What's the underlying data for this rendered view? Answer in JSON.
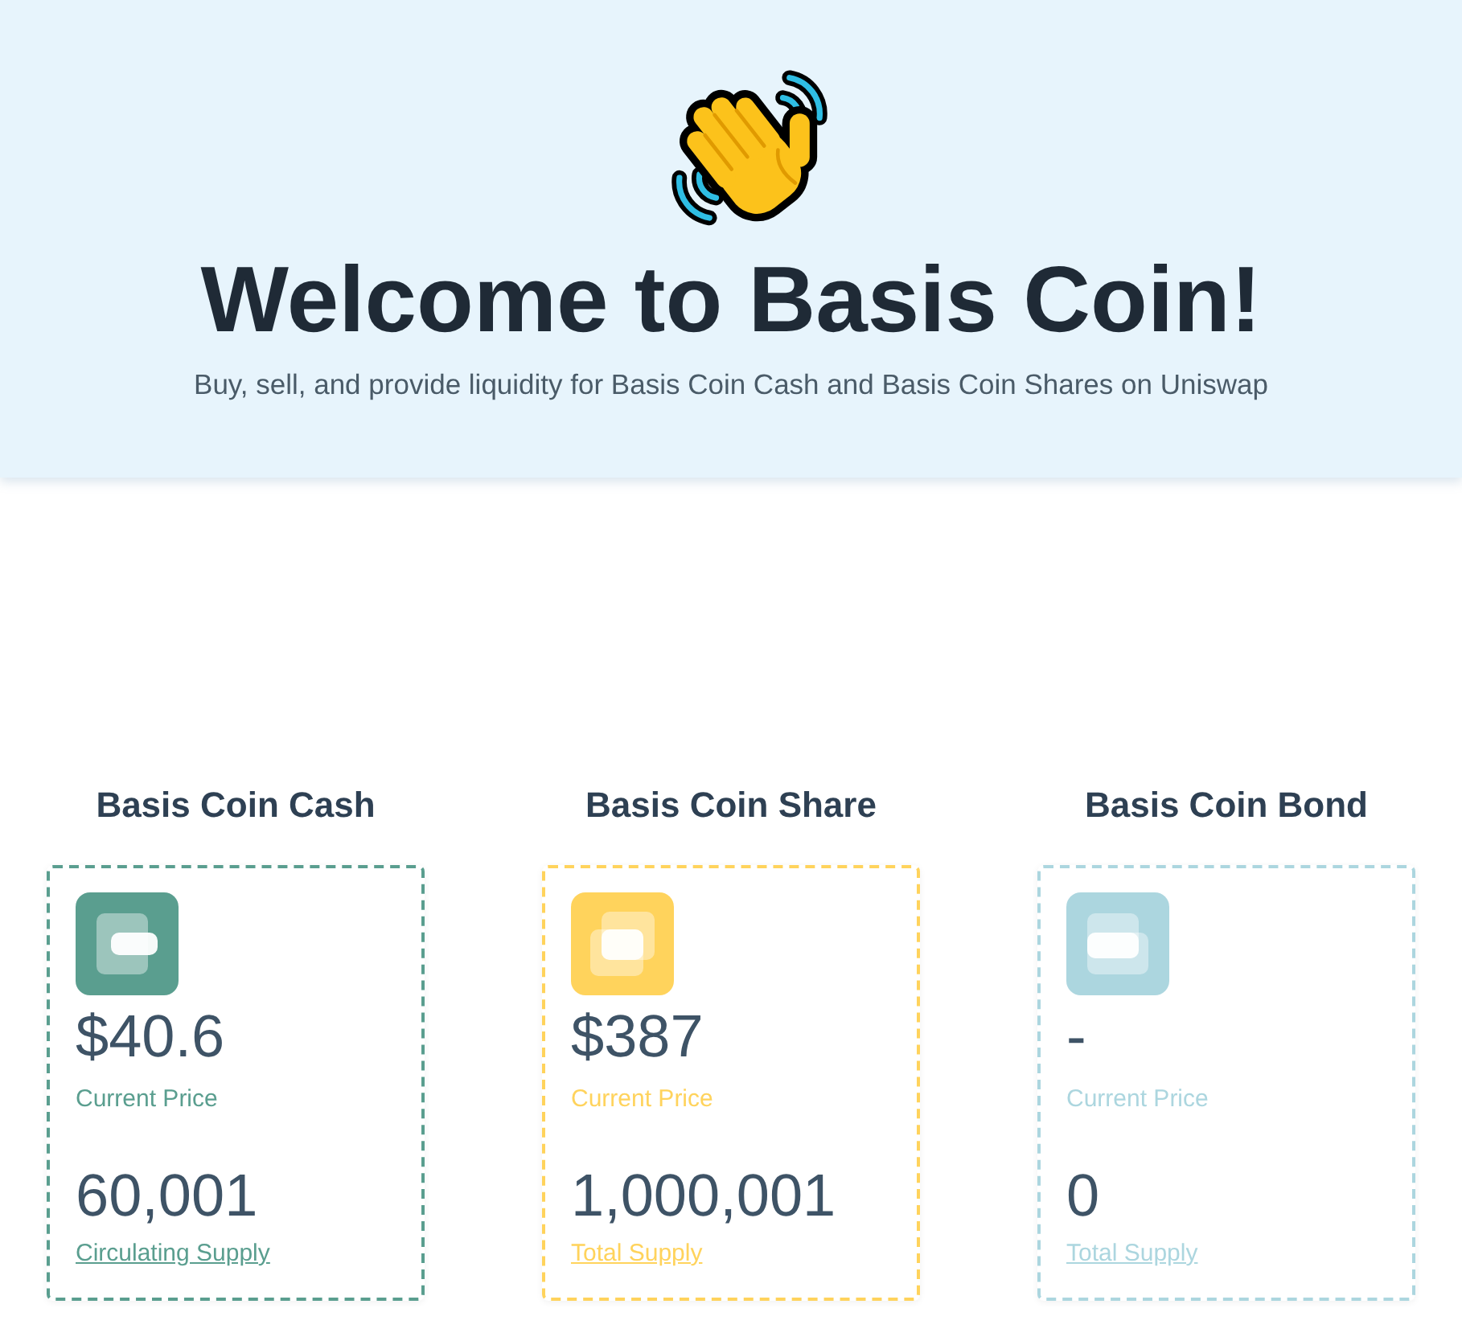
{
  "header": {
    "title": "Welcome to Basis Coin!",
    "subtitle": "Buy, sell, and provide liquidity for Basis Coin Cash and Basis Coin Shares on Uniswap"
  },
  "tokens": [
    {
      "name": "Basis Coin Cash",
      "color": "#5a9e8f",
      "price": "$40.6",
      "price_label": "Current Price",
      "supply": "60,001",
      "supply_label": "Circulating Supply"
    },
    {
      "name": "Basis Coin Share",
      "color": "#ffd35c",
      "price": "$387",
      "price_label": "Current Price",
      "supply": "1,000,001",
      "supply_label": "Total Supply"
    },
    {
      "name": "Basis Coin Bond",
      "color": "#acd6df",
      "price": "-",
      "price_label": "Current Price",
      "supply": "0",
      "supply_label": "Total Supply"
    }
  ]
}
